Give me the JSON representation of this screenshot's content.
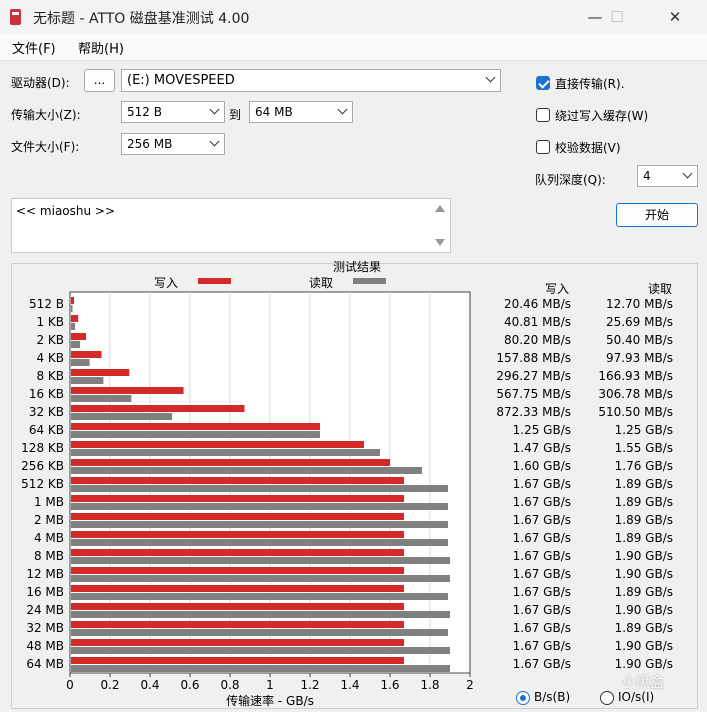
{
  "window": {
    "title": "无标题 - ATTO 磁盘基准测试 4.00",
    "min": "—",
    "max": "☐",
    "close": "✕"
  },
  "menu": {
    "file": "文件(F)",
    "help": "帮助(H)"
  },
  "form": {
    "drive_label": "驱动器(D):",
    "browse_label": "...",
    "drive_value": "(E:) MOVESPEED",
    "transfer_label": "传输大小(Z):",
    "transfer_from": "512 B",
    "to_label": "到",
    "transfer_to": "64 MB",
    "filesize_label": "文件大小(F):",
    "filesize_value": "256 MB",
    "description": "<< miaoshu >>"
  },
  "options": {
    "direct_io": {
      "label": "直接传输(R).",
      "checked": true
    },
    "bypass_write_cache": {
      "label": "绕过写入缓存(W)",
      "checked": false
    },
    "verify_data": {
      "label": "校验数据(V)",
      "checked": false
    },
    "queue_depth_label": "队列深度(Q):",
    "queue_depth_value": "4",
    "start_label": "开始"
  },
  "results": {
    "title": "测试结果",
    "legend_write": "写入",
    "legend_read": "读取",
    "col_write": "写入",
    "col_read": "读取",
    "unit_bytes": "B/s(B)",
    "unit_io": "IO/s(I)",
    "unit_selected": "bytes",
    "write_color": "#d42a2a",
    "read_color": "#808080"
  },
  "chart_data": {
    "type": "bar",
    "orientation": "horizontal",
    "categories": [
      "512 B",
      "1 KB",
      "2 KB",
      "4 KB",
      "8 KB",
      "16 KB",
      "32 KB",
      "64 KB",
      "128 KB",
      "256 KB",
      "512 KB",
      "1 MB",
      "2 MB",
      "4 MB",
      "8 MB",
      "12 MB",
      "16 MB",
      "24 MB",
      "32 MB",
      "48 MB",
      "64 MB"
    ],
    "series": [
      {
        "name": "写入",
        "values": [
          0.02046,
          0.04081,
          0.0802,
          0.15788,
          0.29627,
          0.56775,
          0.87233,
          1.25,
          1.47,
          1.6,
          1.67,
          1.67,
          1.67,
          1.67,
          1.67,
          1.67,
          1.67,
          1.67,
          1.67,
          1.67,
          1.67
        ]
      },
      {
        "name": "读取",
        "values": [
          0.0127,
          0.02569,
          0.0504,
          0.09793,
          0.16693,
          0.30678,
          0.5105,
          1.25,
          1.55,
          1.76,
          1.89,
          1.89,
          1.89,
          1.89,
          1.9,
          1.9,
          1.89,
          1.9,
          1.89,
          1.9,
          1.9
        ]
      }
    ],
    "write_text": [
      "20.46 MB/s",
      "40.81 MB/s",
      "80.20 MB/s",
      "157.88 MB/s",
      "296.27 MB/s",
      "567.75 MB/s",
      "872.33 MB/s",
      "1.25 GB/s",
      "1.47 GB/s",
      "1.60 GB/s",
      "1.67 GB/s",
      "1.67 GB/s",
      "1.67 GB/s",
      "1.67 GB/s",
      "1.67 GB/s",
      "1.67 GB/s",
      "1.67 GB/s",
      "1.67 GB/s",
      "1.67 GB/s",
      "1.67 GB/s",
      "1.67 GB/s"
    ],
    "read_text": [
      "12.70 MB/s",
      "25.69 MB/s",
      "50.40 MB/s",
      "97.93 MB/s",
      "166.93 MB/s",
      "306.78 MB/s",
      "510.50 MB/s",
      "1.25 GB/s",
      "1.55 GB/s",
      "1.76 GB/s",
      "1.89 GB/s",
      "1.89 GB/s",
      "1.89 GB/s",
      "1.89 GB/s",
      "1.90 GB/s",
      "1.90 GB/s",
      "1.89 GB/s",
      "1.90 GB/s",
      "1.89 GB/s",
      "1.90 GB/s",
      "1.90 GB/s"
    ],
    "xticks": [
      "0",
      "0.2",
      "0.4",
      "0.6",
      "0.8",
      "1",
      "1.2",
      "1.4",
      "1.6",
      "1.8",
      "2"
    ],
    "xlim": [
      0,
      2
    ],
    "xlabel": "传输速率 - GB/s",
    "grid": true
  },
  "watermark": "小黑盒"
}
